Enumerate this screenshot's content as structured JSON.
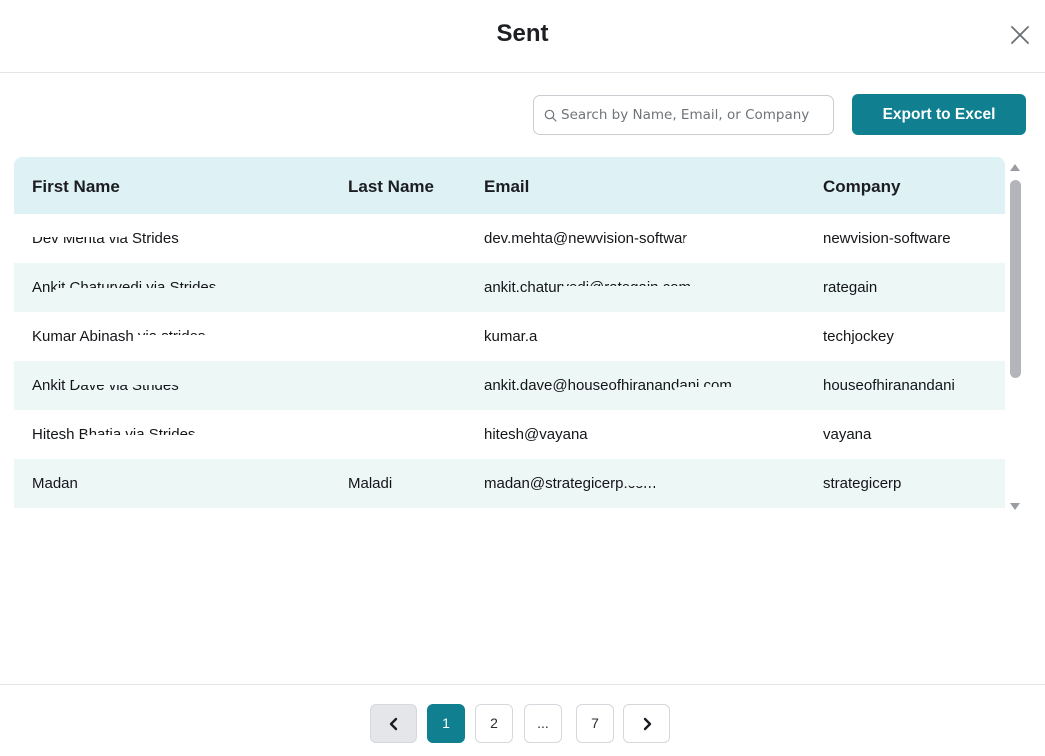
{
  "dialog": {
    "title": "Sent",
    "close_icon": "close-icon"
  },
  "toolbar": {
    "search_placeholder": "Search by Name, Email, or Company",
    "search_value": "",
    "search_icon": "search-icon",
    "export_label": "Export to Excel",
    "accent_color": "#107f8f"
  },
  "table": {
    "columns": [
      "First Name",
      "Last Name",
      "Email",
      "Company"
    ],
    "rows": [
      {
        "first": "Dev Mehta via Strides",
        "last": "",
        "email": "dev.mehta@newvision-software.co",
        "company": "newvision-software"
      },
      {
        "first": "Ankit Chaturvedi via Strides",
        "last": "",
        "email": "ankit.chaturvedi@rategain.com",
        "company": "rategain"
      },
      {
        "first": "Kumar Abinash via strides",
        "last": "",
        "email": "kumar.a",
        "company": "techjockey"
      },
      {
        "first": "Ankit Dave via Strides",
        "last": "",
        "email": "ankit.dave@houseofhiranandani.com",
        "company": "houseofhiranandani"
      },
      {
        "first": "Hitesh Bhatia via Strides",
        "last": "",
        "email": "hitesh@vayana",
        "company": "vayana"
      },
      {
        "first": "Madan",
        "last": "Maladi",
        "email": "madan@strategicerp.com",
        "company": "strategicerp"
      }
    ]
  },
  "pagination": {
    "prev_icon": "chevron-left-icon",
    "next_icon": "chevron-right-icon",
    "pages": [
      "1",
      "2",
      "...",
      "7"
    ],
    "current_page": "1"
  }
}
